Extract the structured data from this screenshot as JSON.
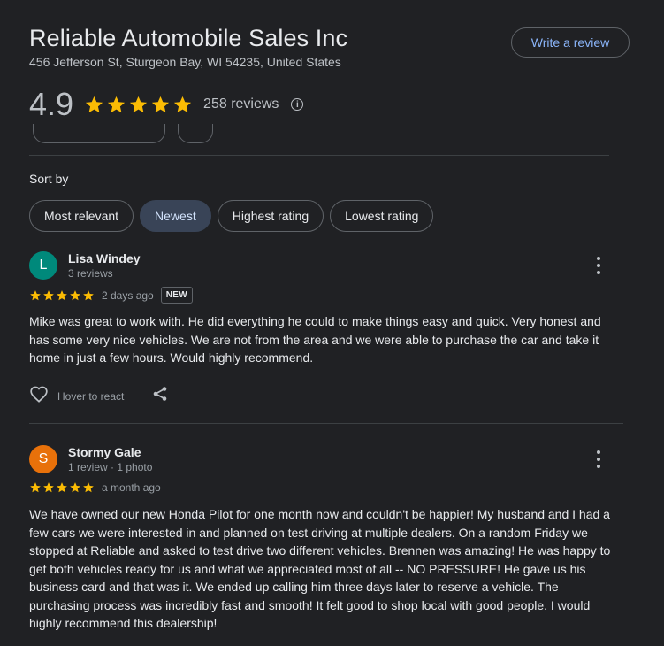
{
  "business": {
    "name": "Reliable Automobile Sales Inc",
    "address": "456 Jefferson St, Sturgeon Bay, WI 54235, United States",
    "rating": "4.9",
    "rating_value": 4.9,
    "review_count": "258 reviews",
    "write_review_label": "Write a review",
    "info_icon": "info-icon",
    "info_glyph": "i"
  },
  "sort": {
    "label": "Sort by",
    "options": [
      {
        "label": "Most relevant",
        "active": false
      },
      {
        "label": "Newest",
        "active": true
      },
      {
        "label": "Highest rating",
        "active": false
      },
      {
        "label": "Lowest rating",
        "active": false
      }
    ]
  },
  "reviews": [
    {
      "initial": "L",
      "avatar_color": "#00897b",
      "name": "Lisa Windey",
      "meta": "3 reviews",
      "stars": 5,
      "time": "2 days ago",
      "badge": "NEW",
      "text": "Mike was great to work with. He did everything he could to make things easy and quick. Very honest and has some very nice vehicles. We are not from the area and we were able to purchase the car and take it home in just a few hours. Would highly recommend.",
      "react_label": "Hover to react"
    },
    {
      "initial": "S",
      "avatar_color": "#e8710a",
      "name": "Stormy Gale",
      "meta": "1 review · 1 photo",
      "stars": 5,
      "time": "a month ago",
      "text": "We have owned our new Honda Pilot for one month now and couldn't be happier! My husband and I had a few cars we were interested in and planned on test driving at multiple dealers. On a random Friday we stopped at Reliable and asked to test drive two different vehicles. Brennen was amazing! He was happy to get both vehicles ready for us and what we appreciated most of all -- NO PRESSURE! He gave us his business card and that was it. We ended up calling him three days later to reserve a vehicle. The purchasing process was incredibly fast and smooth! It felt good to shop local with good people. I would highly recommend this dealership!"
    }
  ],
  "colors": {
    "star": "#fbbc04",
    "accent": "#8ab4f8",
    "background": "#202124"
  },
  "icons": {
    "star": "star-icon",
    "more": "more-vert-icon",
    "heart": "heart-outline-icon",
    "share": "share-icon"
  }
}
